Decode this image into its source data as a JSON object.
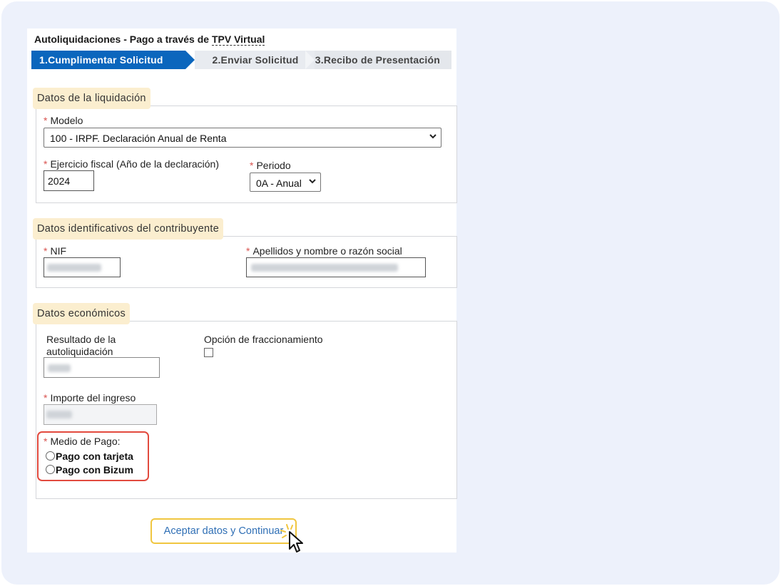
{
  "page": {
    "title_prefix": "Autoliquidaciones - Pago a través de ",
    "title_link": "TPV Virtual"
  },
  "steps": [
    {
      "label": "1.Cumplimentar Solicitud",
      "active": true
    },
    {
      "label": "2.Enviar Solicitud",
      "active": false
    },
    {
      "label": "3.Recibo de Presentación",
      "active": false
    }
  ],
  "liquidacion": {
    "legend": "Datos de la liquidación",
    "modelo_label": "Modelo",
    "modelo_value": "100 - IRPF. Declaración Anual de Renta",
    "ejercicio_label": "Ejercicio fiscal (Año de la declaración)",
    "ejercicio_value": "2024",
    "periodo_label": "Periodo",
    "periodo_value": "0A - Anual"
  },
  "contribuyente": {
    "legend": "Datos identificativos del contribuyente",
    "nif_label": "NIF",
    "nombre_label": "Apellidos y nombre o razón social"
  },
  "economicos": {
    "legend": "Datos económicos",
    "resultado_label_1": "Resultado de la",
    "resultado_label_2": "autoliquidación",
    "fraccionamiento_label": "Opción de fraccionamiento",
    "importe_label": "Importe del ingreso",
    "medio_pago_label": "Medio de Pago:",
    "pago_options": [
      "Pago con tarjeta",
      "Pago con Bizum"
    ]
  },
  "required_mark": "*",
  "submit_label": "Aceptar datos y Continuar",
  "colors": {
    "primary": "#0b66bd",
    "highlight_legend": "#fbeecf",
    "highlight_button": "#f0c640",
    "highlight_payment": "#e24a3e",
    "required": "#d9534f"
  }
}
